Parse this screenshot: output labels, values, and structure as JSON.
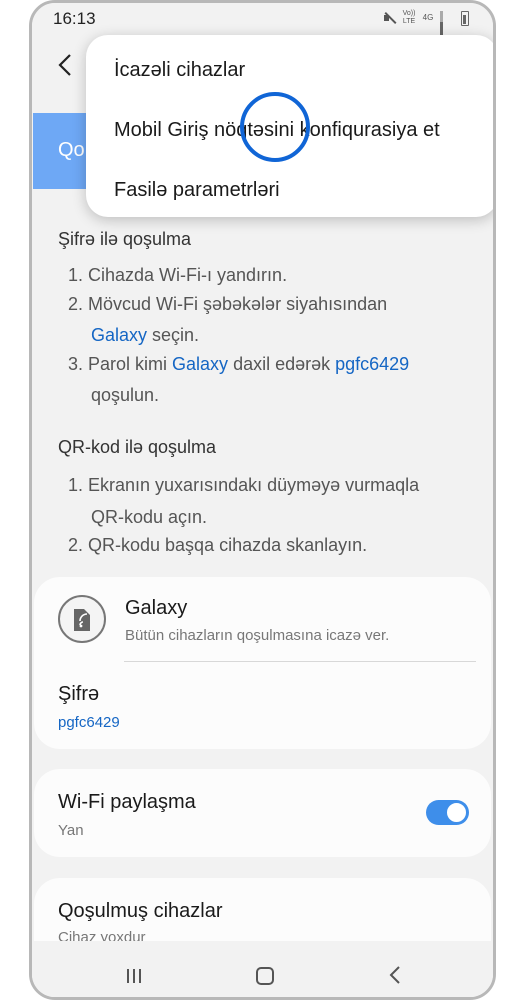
{
  "status_bar": {
    "time": "16:13",
    "network_labels": [
      "Vo)) LTE",
      "4G"
    ]
  },
  "header": {
    "back_icon": "chevron-left-icon",
    "tab_label_partial": "Qo"
  },
  "menu": {
    "items": [
      {
        "label": "İcazəli cihazlar"
      },
      {
        "label": "Mobil Giriş nöqtəsini konfiqurasiya et"
      },
      {
        "label": "Fasilə parametrləri"
      }
    ]
  },
  "instructions": {
    "password_heading": "Şifrə ilə qoşulma",
    "password_steps": {
      "s1": "1. Cihazda Wi-Fi-ı yandırın.",
      "s2_line1": "2. Mövcud Wi-Fi şəbəkələr siyahısından",
      "s2_link": "Galaxy",
      "s2_tail": " seçin.",
      "s3_pre": "3. Parol kimi ",
      "s3_link1": "Galaxy",
      "s3_mid": " daxil edərək ",
      "s3_link2": "pgfc6429",
      "s3_line2": "qoşulun."
    },
    "qr_heading": "QR-kod ilə qoşulma",
    "qr_steps": {
      "s1_line1": "1. Ekranın yuxarısındakı düyməyə vurmaqla",
      "s1_line2": "QR-kodu açın.",
      "s2": "2. QR-kodu başqa cihazda skanlayın."
    }
  },
  "network": {
    "name": "Galaxy",
    "description": "Bütün cihazların qoşulmasına icazə ver.",
    "icon": "hotspot-phone-icon",
    "password_label": "Şifrə",
    "password_value": "pgfc6429"
  },
  "wifi_sharing": {
    "label": "Wi-Fi paylaşma",
    "state_text": "Yan",
    "toggle_on": true
  },
  "connected_devices": {
    "label": "Qoşulmuş cihazlar",
    "status": "Cihaz yoxdur"
  },
  "nav_bar": {
    "buttons": [
      "recent-apps-icon",
      "home-icon",
      "back-icon"
    ]
  },
  "colors": {
    "accent": "#3e8eea",
    "link": "#1566c4",
    "touch_indicator": "#1065d6",
    "pill": "#6ea8f5"
  }
}
